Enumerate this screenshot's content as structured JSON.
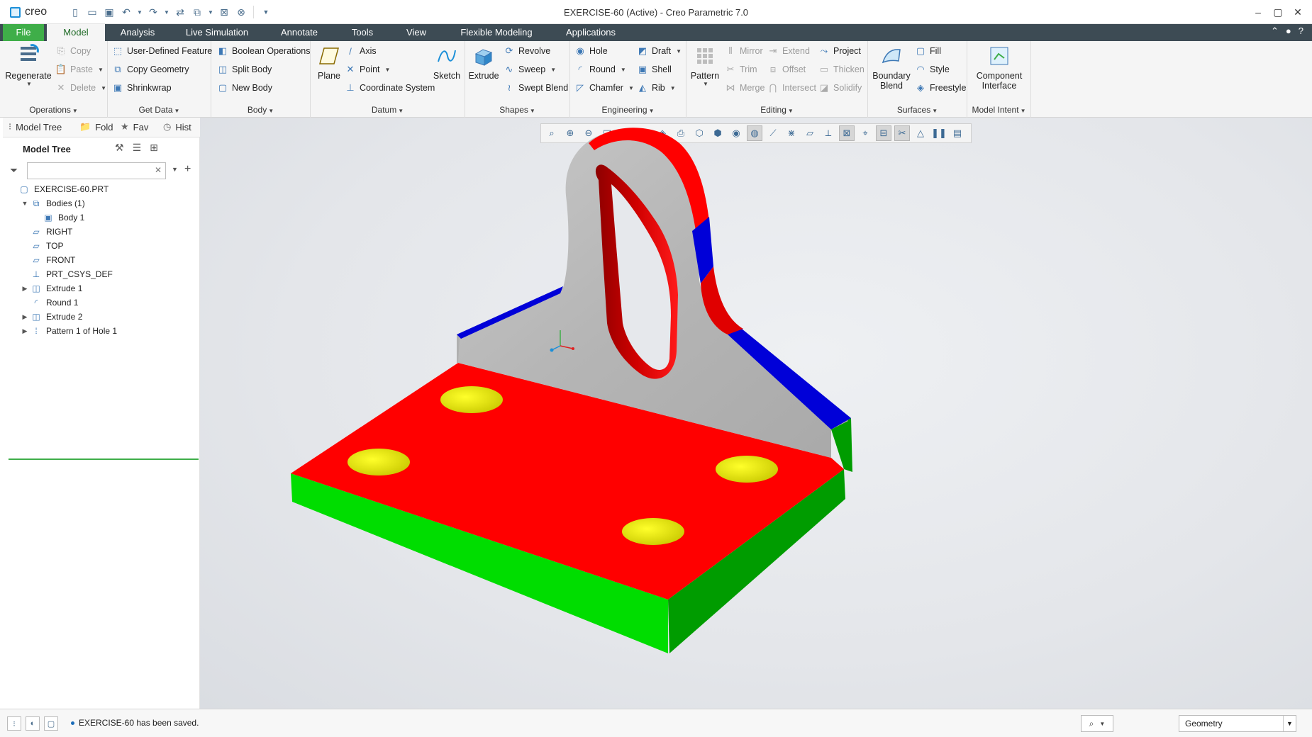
{
  "app": {
    "logo": "creo",
    "window_title": "EXERCISE-60 (Active) - Creo Parametric 7.0"
  },
  "tabs": [
    "File",
    "Model",
    "Analysis",
    "Live Simulation",
    "Annotate",
    "Tools",
    "View",
    "Flexible Modeling",
    "Applications"
  ],
  "ribbon": {
    "operations": {
      "label": "Operations",
      "regenerate": "Regenerate",
      "copy": "Copy",
      "paste": "Paste",
      "delete": "Delete"
    },
    "get_data": {
      "label": "Get Data",
      "udf": "User-Defined Feature",
      "copy_geometry": "Copy Geometry",
      "shrinkwrap": "Shrinkwrap"
    },
    "body": {
      "label": "Body",
      "boolean": "Boolean Operations",
      "split": "Split Body",
      "new": "New Body"
    },
    "datum": {
      "label": "Datum",
      "plane": "Plane",
      "axis": "Axis",
      "point": "Point",
      "csys": "Coordinate System",
      "sketch": "Sketch"
    },
    "shapes": {
      "label": "Shapes",
      "extrude": "Extrude",
      "revolve": "Revolve",
      "sweep": "Sweep",
      "swept_blend": "Swept Blend"
    },
    "engineering": {
      "label": "Engineering",
      "hole": "Hole",
      "round": "Round",
      "chamfer": "Chamfer",
      "draft": "Draft",
      "shell": "Shell",
      "rib": "Rib"
    },
    "editing": {
      "label": "Editing",
      "pattern": "Pattern",
      "mirror": "Mirror",
      "trim": "Trim",
      "merge": "Merge",
      "extend": "Extend",
      "offset": "Offset",
      "intersect": "Intersect",
      "project": "Project",
      "thicken": "Thicken",
      "solidify": "Solidify"
    },
    "surfaces": {
      "label": "Surfaces",
      "boundary_blend_1": "Boundary",
      "boundary_blend_2": "Blend",
      "fill": "Fill",
      "style": "Style",
      "freestyle": "Freestyle"
    },
    "model_intent": {
      "label": "Model Intent",
      "component_1": "Component",
      "component_2": "Interface"
    }
  },
  "left_panel": {
    "tabs": [
      "Model Tree",
      "Fold",
      "Fav",
      "Hist"
    ],
    "tree_title": "Model Tree",
    "search_placeholder": "",
    "tree": [
      {
        "label": "EXERCISE-60.PRT",
        "icon": "part-icon",
        "indent": 0,
        "expander": ""
      },
      {
        "label": "Bodies (1)",
        "icon": "bodies-icon",
        "indent": 1,
        "expander": "▼"
      },
      {
        "label": "Body 1",
        "icon": "body-icon",
        "indent": 2,
        "expander": ""
      },
      {
        "label": "RIGHT",
        "icon": "datum-plane-icon",
        "indent": 1,
        "expander": ""
      },
      {
        "label": "TOP",
        "icon": "datum-plane-icon",
        "indent": 1,
        "expander": ""
      },
      {
        "label": "FRONT",
        "icon": "datum-plane-icon",
        "indent": 1,
        "expander": ""
      },
      {
        "label": "PRT_CSYS_DEF",
        "icon": "csys-icon",
        "indent": 1,
        "expander": ""
      },
      {
        "label": "Extrude 1",
        "icon": "extrude-icon",
        "indent": 1,
        "expander": "▶"
      },
      {
        "label": "Round 1",
        "icon": "round-icon",
        "indent": 1,
        "expander": ""
      },
      {
        "label": "Extrude 2",
        "icon": "extrude-icon",
        "indent": 1,
        "expander": "▶"
      },
      {
        "label": "Pattern 1 of Hole 1",
        "icon": "pattern-icon",
        "indent": 1,
        "expander": "▶"
      }
    ]
  },
  "status": {
    "message": "EXERCISE-60 has been saved.",
    "filter_value": "Geometry"
  },
  "colors": {
    "file_tab": "#3fae49",
    "tab_bar": "#3d4b54",
    "model_red": "#ff0000",
    "model_green": "#00dd00",
    "model_blue": "#0000d8",
    "model_yellow": "#e6e600",
    "model_gray": "#b8b8b8"
  }
}
